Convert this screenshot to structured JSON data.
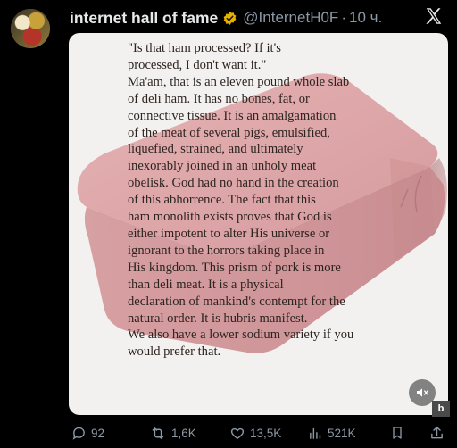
{
  "tweet": {
    "author_name": "internet hall of fame",
    "handle": "@InternetH0F",
    "separator": "·",
    "time": "10 ч."
  },
  "quote_lines": [
    "\"Is that ham processed? If it's",
    "processed, I don't want it.\"",
    "Ma'am, that is an eleven pound whole slab",
    "of deli ham. It has no bones, fat, or",
    "connective tissue. It is an amalgamation",
    "of the meat of several pigs, emulsified,",
    "liquefied, strained, and ultimately",
    "inexorably joined in an unholy meat",
    "obelisk. God had no hand in the creation",
    "of this abhorrence. The fact that this",
    "ham monolith exists proves that God is",
    "either impotent to alter His universe or",
    "ignorant to the horrors taking place in",
    "His kingdom. This prism of pork is more",
    "than deli meat. It is a physical",
    "declaration of mankind's contempt for the",
    "natural order. It is hubris manifest.",
    "We also have a lower sodium variety if you",
    "would prefer that."
  ],
  "corner_badge": "b",
  "actions": {
    "replies": "92",
    "reposts": "1,6K",
    "likes": "13,5K",
    "views": "521K"
  },
  "colors": {
    "background": "#000000",
    "card": "#f3f1ef",
    "ham": "#d9a3a6",
    "verified": "#e8b100",
    "muted_text": "#8b98a5"
  },
  "icons": [
    "verified-badge-icon",
    "x-logo-icon",
    "mute-icon",
    "reply-icon",
    "repost-icon",
    "like-icon",
    "views-icon",
    "bookmark-icon",
    "share-icon"
  ]
}
